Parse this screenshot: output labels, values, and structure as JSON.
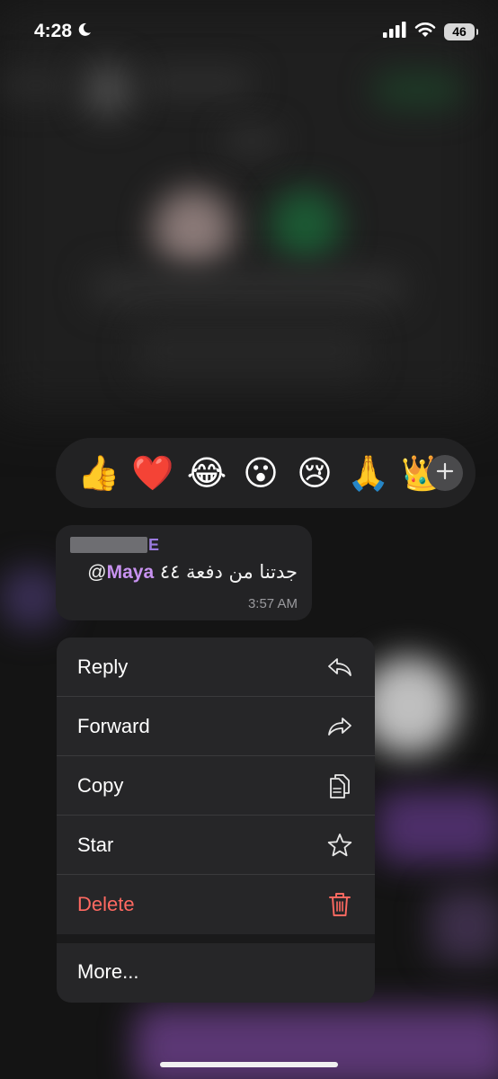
{
  "status_bar": {
    "time": "4:28",
    "battery": "46",
    "icons": [
      "moon-icon",
      "signal-icon",
      "wifi-icon",
      "battery-icon"
    ]
  },
  "reactions": {
    "emojis": [
      "👍",
      "❤️",
      "😂",
      "😮",
      "😢",
      "🙏",
      "👑"
    ],
    "add_icon": "plus-icon"
  },
  "message": {
    "sender_suffix": "E",
    "mention": "Maya",
    "at_sign": "@",
    "text": "جدتنا من دفعة ٤٤",
    "time": "3:57 AM"
  },
  "menu": {
    "items": [
      {
        "label": "Reply",
        "icon": "reply-icon"
      },
      {
        "label": "Forward",
        "icon": "forward-icon"
      },
      {
        "label": "Copy",
        "icon": "copy-icon"
      },
      {
        "label": "Star",
        "icon": "star-icon"
      },
      {
        "label": "Delete",
        "icon": "trash-icon"
      }
    ],
    "more_label": "More..."
  },
  "colors": {
    "mention": "#c892f0",
    "sender": "#9b7bdf",
    "delete": "#ff6961",
    "menu_bg": "#262628"
  }
}
